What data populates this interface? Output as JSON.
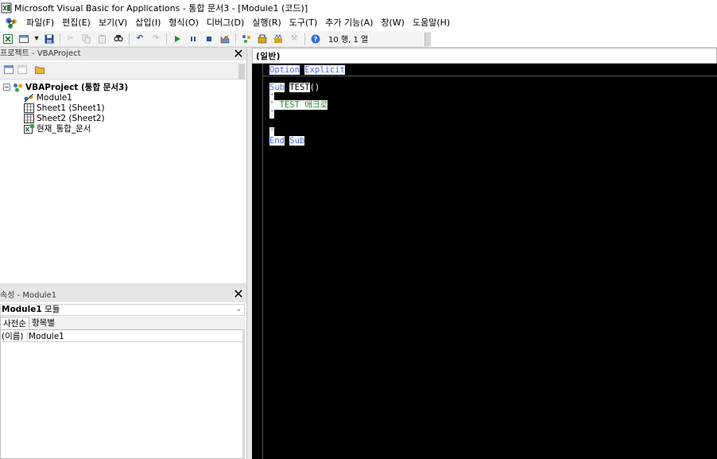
{
  "window": {
    "title": "Microsoft Visual Basic for Applications - 통합 문서3 - [Module1 (코드)]"
  },
  "menu": {
    "items": [
      "파일(F)",
      "편집(E)",
      "보기(V)",
      "삽입(I)",
      "형식(O)",
      "디버그(D)",
      "실행(R)",
      "도구(T)",
      "추가 기능(A)",
      "창(W)",
      "도움말(H)"
    ]
  },
  "toolbar": {
    "position_label": "10 행, 1 열"
  },
  "project_pane": {
    "title": "프로젝트 - VBAProject",
    "tree": {
      "root": "VBAProject (통합 문서3)",
      "items": [
        "Module1",
        "Sheet1 (Sheet1)",
        "Sheet2 (Sheet2)",
        "현재_통합_문서"
      ]
    }
  },
  "properties_pane": {
    "title": "속성 - Module1",
    "object_name": "Module1",
    "object_type": "모듈",
    "tabs": [
      "사전순",
      "항목별"
    ],
    "rows": [
      {
        "key": "(이름)",
        "value": "Module1"
      }
    ]
  },
  "code_window": {
    "object_combo": "(일반)",
    "lines": {
      "option": "Option",
      "explicit": "Explicit",
      "sub": "Sub",
      "sub_name": "TEST",
      "parens": "()",
      "quote1": "'",
      "comment": "' TEST 매크로",
      "quote2": "'",
      "quote3": "'",
      "end": "End",
      "end_sub": "Sub"
    }
  }
}
